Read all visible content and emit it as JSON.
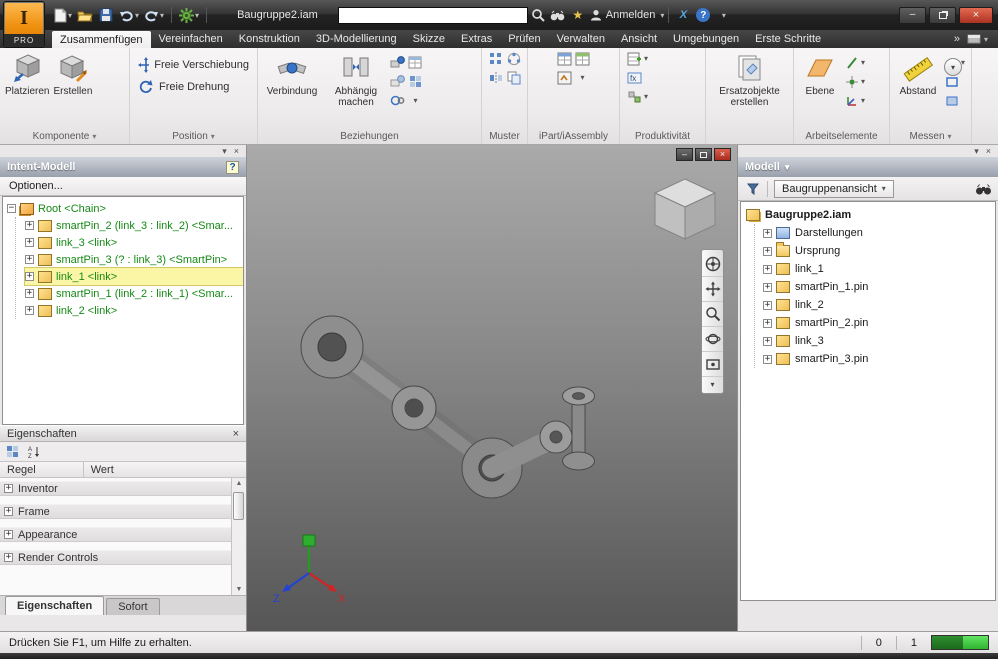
{
  "window": {
    "app_logo": "I",
    "app_badge": "PRO",
    "doc_title": "Baugruppe2.iam",
    "search_value": "",
    "signin_label": "Anmelden"
  },
  "icons": {
    "chevron_down": "▾",
    "chevron_double": "»",
    "close": "×",
    "minimize": "–",
    "help": "?",
    "plus": "+",
    "minus": "−",
    "scroll_up": "▲",
    "scroll_down": "▼",
    "a360": "X",
    "star": "★"
  },
  "colors": {
    "app_orange": "#ef8f0e",
    "selection_yellow": "#fbf6a6",
    "tree_text_green": "#168a16",
    "status_green_dark": "#1c6b1c",
    "status_green_bright": "#2fb52f",
    "close_red": "#ad3123"
  },
  "ribbon": {
    "tabs": [
      {
        "label": "Zusammenfügen",
        "active": true
      },
      {
        "label": "Vereinfachen"
      },
      {
        "label": "Konstruktion"
      },
      {
        "label": "3D-Modellierung"
      },
      {
        "label": "Skizze"
      },
      {
        "label": "Extras"
      },
      {
        "label": "Prüfen"
      },
      {
        "label": "Verwalten"
      },
      {
        "label": "Ansicht"
      },
      {
        "label": "Umgebungen"
      },
      {
        "label": "Erste Schritte"
      }
    ],
    "buttons": {
      "platzieren": "Platzieren",
      "erstellen": "Erstellen",
      "freie_verschiebung": "Freie Verschiebung",
      "freie_drehung": "Freie Drehung",
      "verbindung": "Verbindung",
      "abhaengig": "Abhängig machen",
      "ersatzobjekte": "Ersatzobjekte erstellen",
      "ebene": "Ebene",
      "abstand": "Abstand"
    },
    "group_labels": {
      "komponente": "Komponente",
      "position": "Position",
      "beziehungen": "Beziehungen",
      "muster": "Muster",
      "ipart": "iPart/iAssembly",
      "produktivitaet": "Produktivität",
      "arbeitselemente": "Arbeitselemente",
      "messen": "Messen"
    }
  },
  "intent_panel": {
    "title": "Intent-Modell",
    "options_label": "Optionen...",
    "items": [
      {
        "label": "Root <Chain>"
      },
      {
        "label": "smartPin_2 (link_3 : link_2) <Smar..."
      },
      {
        "label": "link_3 <link>"
      },
      {
        "label": "smartPin_3 (? : link_3) <SmartPin>"
      },
      {
        "label": "link_1 <link>",
        "selected": true
      },
      {
        "label": "smartPin_1 (link_2 : link_1) <Smar..."
      },
      {
        "label": "link_2 <link>"
      }
    ]
  },
  "properties_panel": {
    "title": "Eigenschaften",
    "col_rule": "Regel",
    "col_value": "Wert",
    "rows": [
      {
        "label": "Inventor"
      },
      {
        "label": "Frame"
      },
      {
        "label": "Appearance"
      },
      {
        "label": "Render Controls"
      }
    ],
    "tab_eigenschaften": "Eigenschaften",
    "tab_sofort": "Sofort"
  },
  "model_panel": {
    "title": "Modell",
    "view_mode": "Baugruppenansicht",
    "items": [
      {
        "label": "Baugruppe2.iam"
      },
      {
        "label": "Darstellungen"
      },
      {
        "label": "Ursprung"
      },
      {
        "label": "link_1"
      },
      {
        "label": "smartPin_1.pin"
      },
      {
        "label": "link_2"
      },
      {
        "label": "smartPin_2.pin"
      },
      {
        "label": "link_3"
      },
      {
        "label": "smartPin_3.pin"
      }
    ]
  },
  "viewport": {
    "axis_x": "X",
    "axis_z": "Z"
  },
  "statusbar": {
    "hint": "Drücken Sie F1, um Hilfe zu erhalten.",
    "count_a": "0",
    "count_b": "1"
  }
}
